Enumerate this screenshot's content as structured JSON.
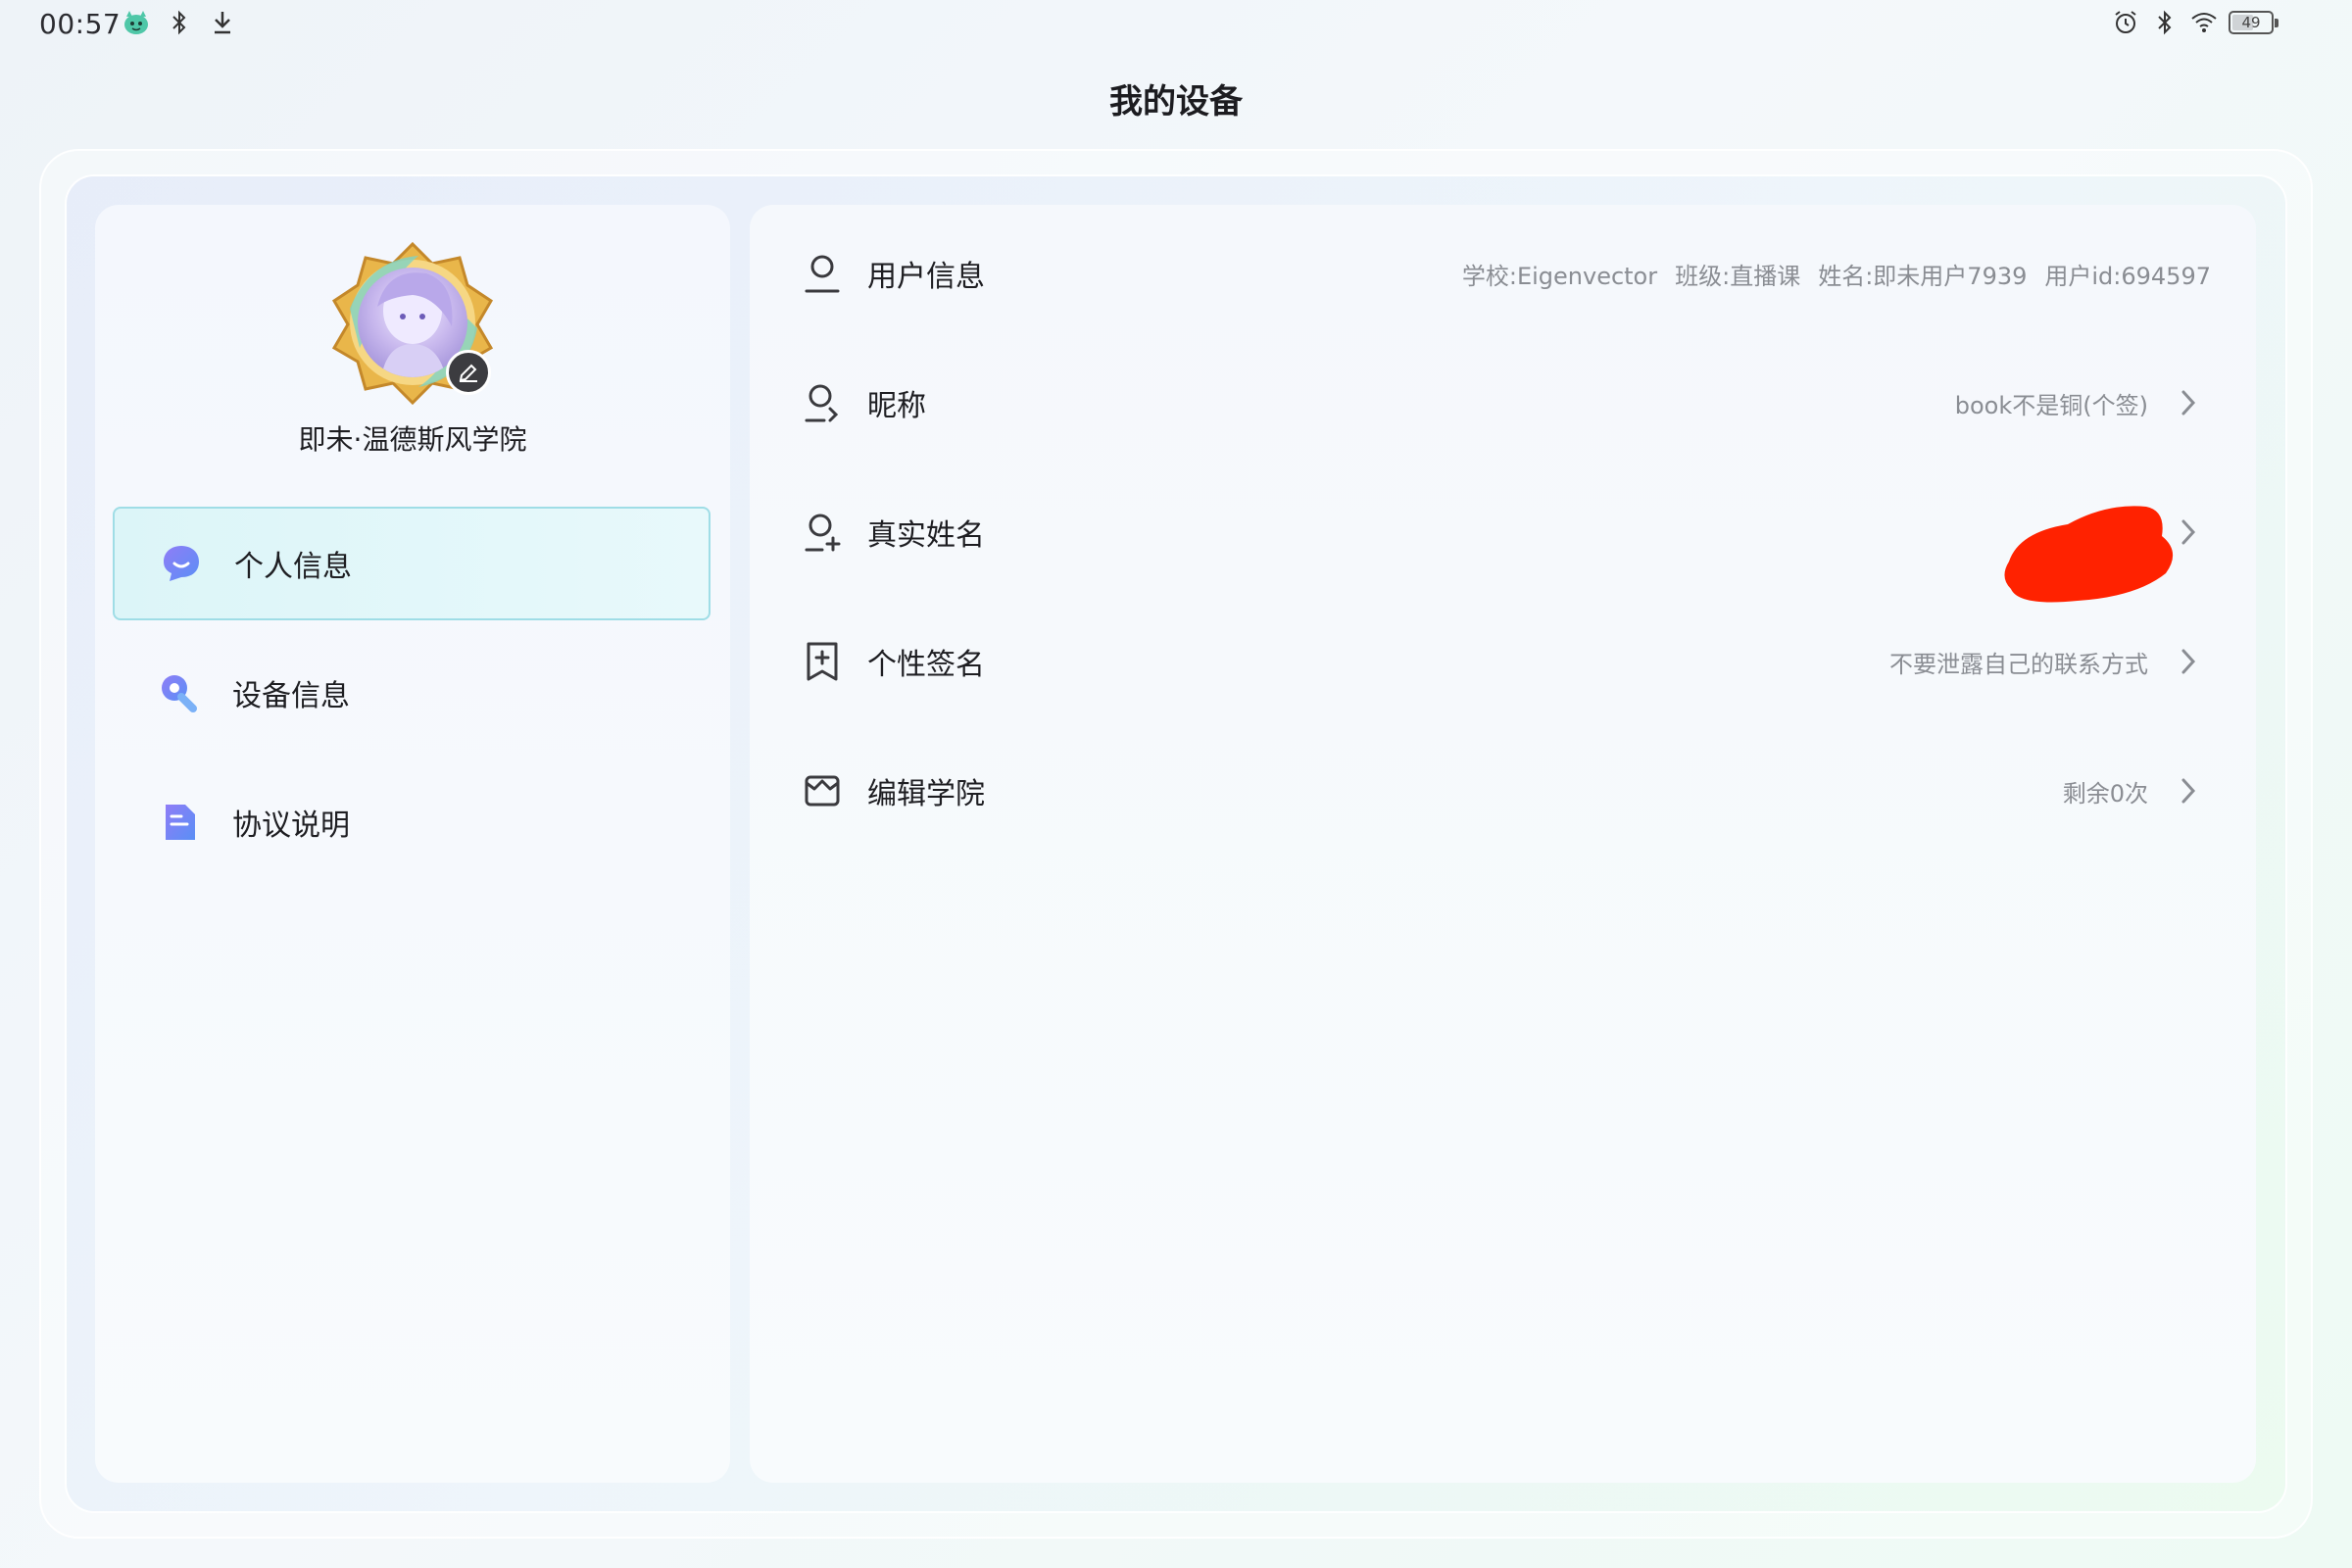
{
  "status_bar": {
    "time": "00:57",
    "battery": "49",
    "left_icons": [
      "app-mascot-icon",
      "bluetooth-icon",
      "download-icon"
    ],
    "right_icons": [
      "alarm-icon",
      "bluetooth-icon",
      "wifi-icon",
      "battery-icon"
    ]
  },
  "page": {
    "title": "我的设备"
  },
  "profile": {
    "name": "即未·温德斯风学院"
  },
  "sidebar": {
    "items": [
      {
        "label": "个人信息",
        "icon": "chat-bubble-icon",
        "active": true
      },
      {
        "label": "设备信息",
        "icon": "wrench-icon",
        "active": false
      },
      {
        "label": "协议说明",
        "icon": "document-icon",
        "active": false
      }
    ]
  },
  "rows": {
    "user_info": {
      "label": "用户信息",
      "icon": "user-icon",
      "values": [
        "学校:Eigenvector",
        "班级:直播课",
        "姓名:即未用户7939",
        "用户id:694597"
      ]
    },
    "nickname": {
      "label": "昵称",
      "icon": "user-edit-icon",
      "value": "book不是铜(个签)"
    },
    "real_name": {
      "label": "真实姓名",
      "icon": "user-add-icon",
      "value": ""
    },
    "signature": {
      "label": "个性签名",
      "icon": "bookmark-plus-icon",
      "value": "不要泄露自己的联系方式"
    },
    "academy": {
      "label": "编辑学院",
      "icon": "building-icon",
      "value": "剩余0次"
    }
  },
  "colors": {
    "accent_cyan": "#9fdde6",
    "icon_purple": "#7b6cf0",
    "redaction_red": "#ff2200"
  }
}
